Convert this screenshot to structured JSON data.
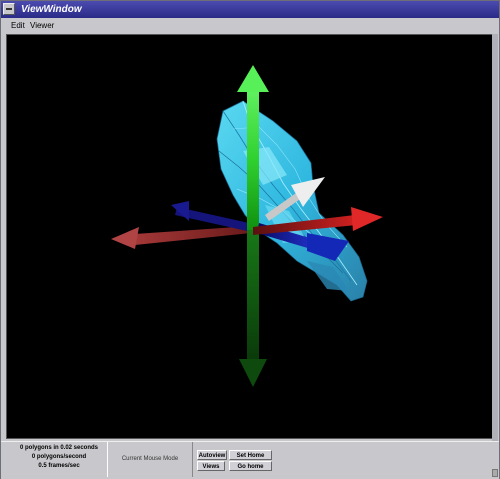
{
  "window": {
    "title": "ViewWindow"
  },
  "menubar": {
    "items": [
      "Edit",
      "Viewer"
    ]
  },
  "status": {
    "polygons_time": "0 polygons in 0.02 seconds",
    "polygons_rate": "0 polygons/second",
    "frame_rate": "0.5 frames/sec",
    "mouse_mode": "Current Mouse Mode"
  },
  "buttons": {
    "autoview": "Autoview",
    "set_home_view": "Set Home View",
    "views": "Views",
    "go_home": "Go home"
  },
  "colors": {
    "viewport_background": "#000000",
    "x_axis": "#c0101e",
    "y_axis": "#20c020",
    "z_axis": "#1a2ab8",
    "surface": "#38c8e8"
  }
}
